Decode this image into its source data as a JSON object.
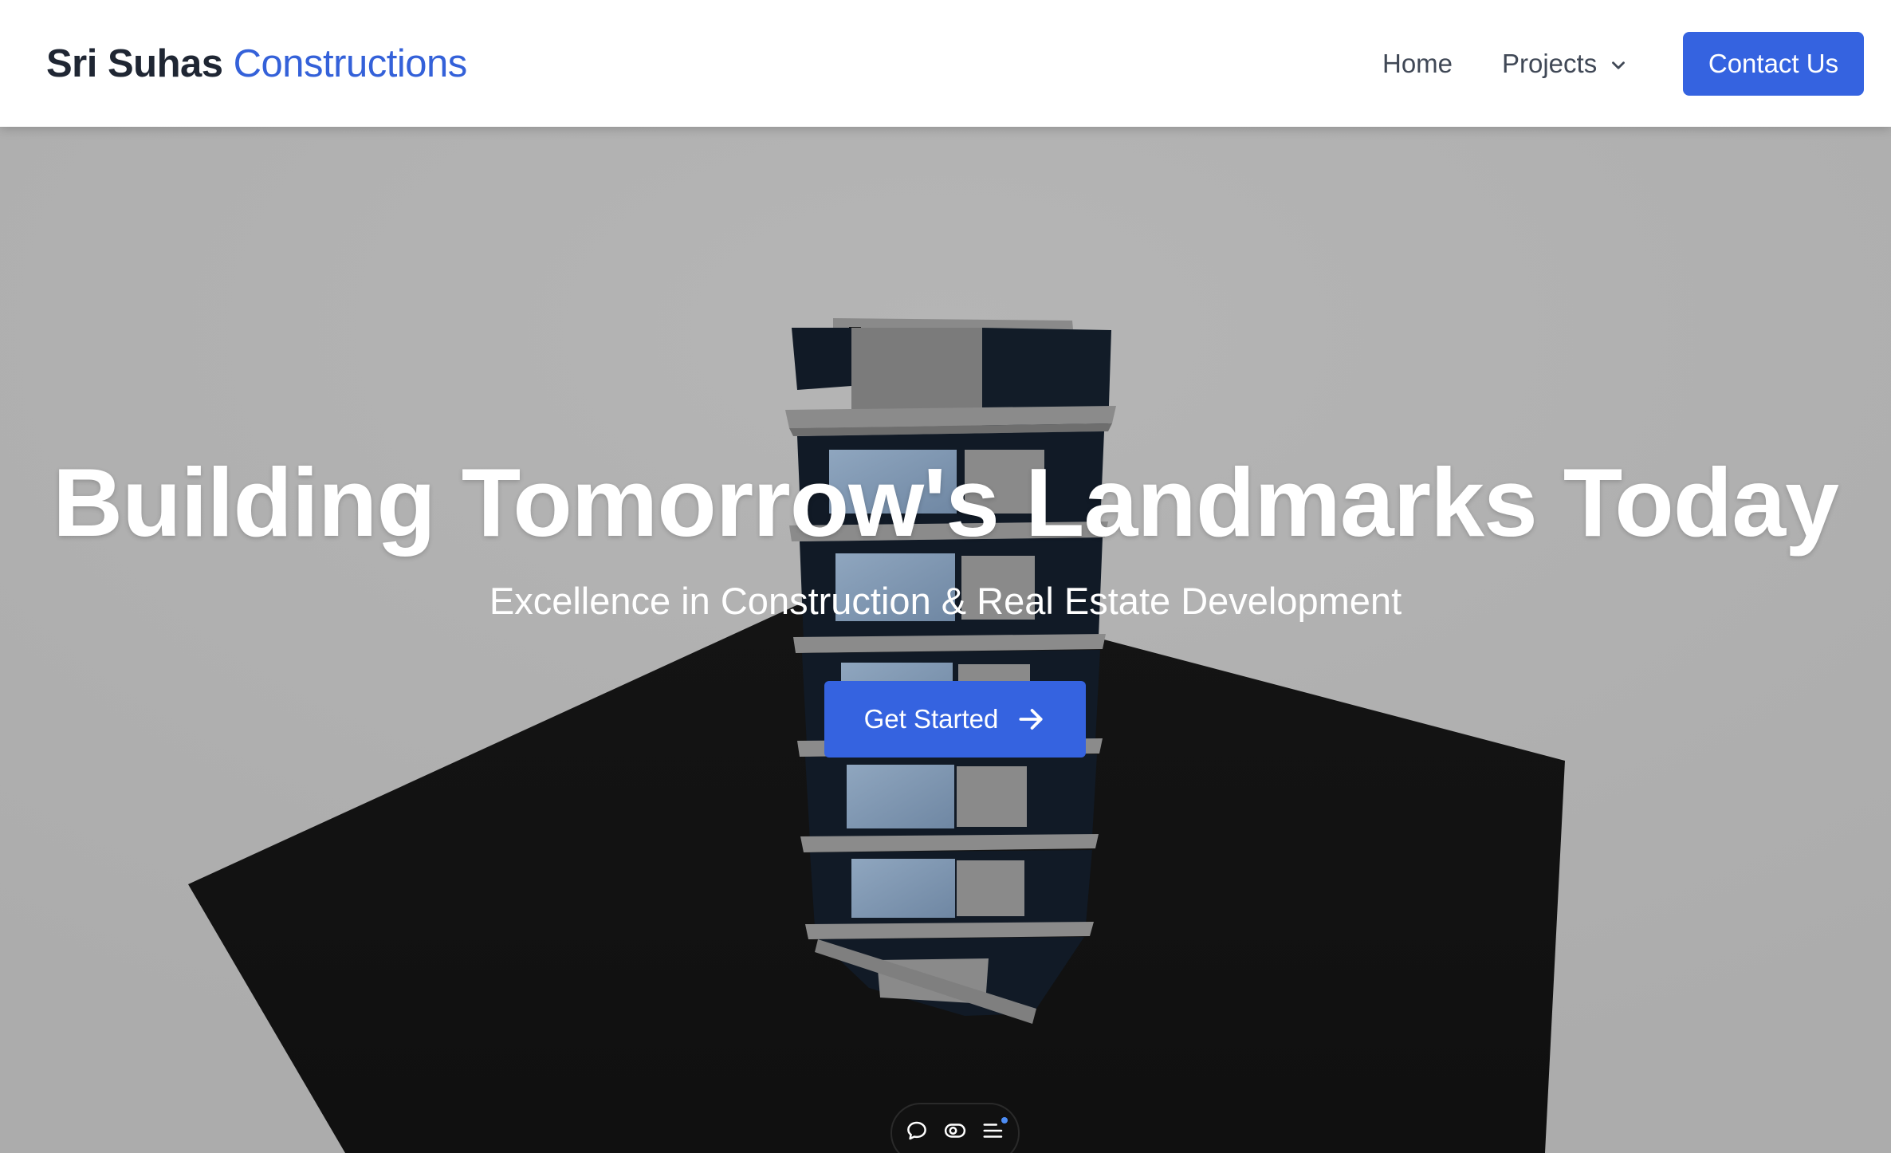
{
  "brand": {
    "primary": "Sri Suhas",
    "secondary": "Constructions"
  },
  "nav": {
    "home": "Home",
    "projects": "Projects",
    "contact": "Contact Us"
  },
  "hero": {
    "title": "Building Tomorrow's Landmarks Today",
    "subtitle": "Excellence in Construction & Real Estate Development",
    "cta": "Get Started"
  },
  "toolbar": {
    "icons": [
      "comment-icon",
      "eye-icon",
      "list-icon"
    ]
  },
  "colors": {
    "accent": "#3563e0",
    "brand_dark": "#1f2633",
    "brand_blue": "#3461d9",
    "nav_text": "#404856",
    "background_gray": "#b1b1b1"
  }
}
